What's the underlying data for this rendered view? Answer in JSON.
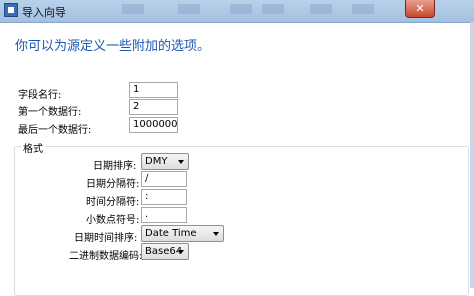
{
  "window": {
    "title": "导入向导",
    "close_icon": "close-icon"
  },
  "header": {
    "text": "你可以为源定义一些附加的选项。"
  },
  "form": {
    "field_name_row": {
      "label": "字段名行:",
      "value": "1"
    },
    "first_data_row": {
      "label": "第一个数据行:",
      "value": "2"
    },
    "last_data_row": {
      "label": "最后一个数据行:",
      "value": "1000000"
    }
  },
  "format": {
    "title": "格式",
    "date_order": {
      "label": "日期排序:",
      "value": "DMY"
    },
    "date_separator": {
      "label": "日期分隔符:",
      "value": "/"
    },
    "time_separator": {
      "label": "时间分隔符:",
      "value": ":"
    },
    "decimal_symbol": {
      "label": "小数点符号:",
      "value": "."
    },
    "datetime_order": {
      "label": "日期时间排序:",
      "value": "Date Time"
    },
    "binary_encoding": {
      "label": "二进制数据编码:",
      "value": "Base64"
    }
  }
}
